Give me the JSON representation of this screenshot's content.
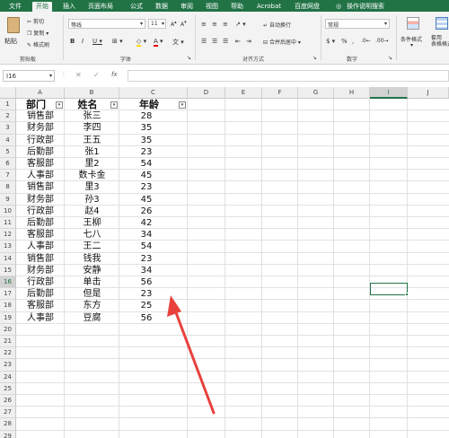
{
  "ribbon_tabs": [
    "文件",
    "开始",
    "插入",
    "页面布局",
    "公式",
    "数据",
    "审阅",
    "视图",
    "帮助",
    "Acrobat",
    "百度网盘",
    "操作说明搜索"
  ],
  "clipboard": {
    "cut": "剪切",
    "copy": "复制",
    "format_painter": "格式刷",
    "paste": "粘贴",
    "group": "剪贴板"
  },
  "font": {
    "name": "等线",
    "size": "11",
    "group": "字体"
  },
  "alignment": {
    "wrap": "自动换行",
    "merge": "合并后居中",
    "group": "对齐方式"
  },
  "number": {
    "format": "常规",
    "group": "数字"
  },
  "styles": {
    "conditional": "条件格式",
    "table": "套用\n表格格式"
  },
  "formula_bar": {
    "name_box": "I16",
    "fx": "fx",
    "formula": ""
  },
  "columns": [
    "A",
    "B",
    "C",
    "D",
    "E",
    "F",
    "G",
    "H",
    "I",
    "J"
  ],
  "rows": [
    "1",
    "2",
    "3",
    "4",
    "5",
    "6",
    "7",
    "8",
    "9",
    "10",
    "11",
    "12",
    "13",
    "14",
    "15",
    "16",
    "17",
    "18",
    "19",
    "20",
    "21",
    "22",
    "23",
    "24",
    "25",
    "26",
    "27",
    "28",
    "29"
  ],
  "table": {
    "headers": [
      "部门",
      "姓名",
      "年龄"
    ],
    "data": [
      [
        "销售部",
        "张三",
        "28"
      ],
      [
        "财务部",
        "李四",
        "35"
      ],
      [
        "行政部",
        "王五",
        "35"
      ],
      [
        "后勤部",
        "张1",
        "23"
      ],
      [
        "客服部",
        "里2",
        "54"
      ],
      [
        "人事部",
        "数卡金",
        "45"
      ],
      [
        "销售部",
        "里3",
        "23"
      ],
      [
        "财务部",
        "孙3",
        "45"
      ],
      [
        "行政部",
        "赵4",
        "26"
      ],
      [
        "后勤部",
        "王柳",
        "42"
      ],
      [
        "客服部",
        "七八",
        "34"
      ],
      [
        "人事部",
        "王二",
        "54"
      ],
      [
        "销售部",
        "钱我",
        "23"
      ],
      [
        "财务部",
        "安静",
        "34"
      ],
      [
        "行政部",
        "单击",
        "56"
      ],
      [
        "后勤部",
        "但是",
        "23"
      ],
      [
        "客服部",
        "东方",
        "25"
      ],
      [
        "人事部",
        "豆腐",
        "56"
      ]
    ]
  },
  "selected_cell": "I16",
  "accent": "#217346",
  "annotation_color": "#e8413c"
}
